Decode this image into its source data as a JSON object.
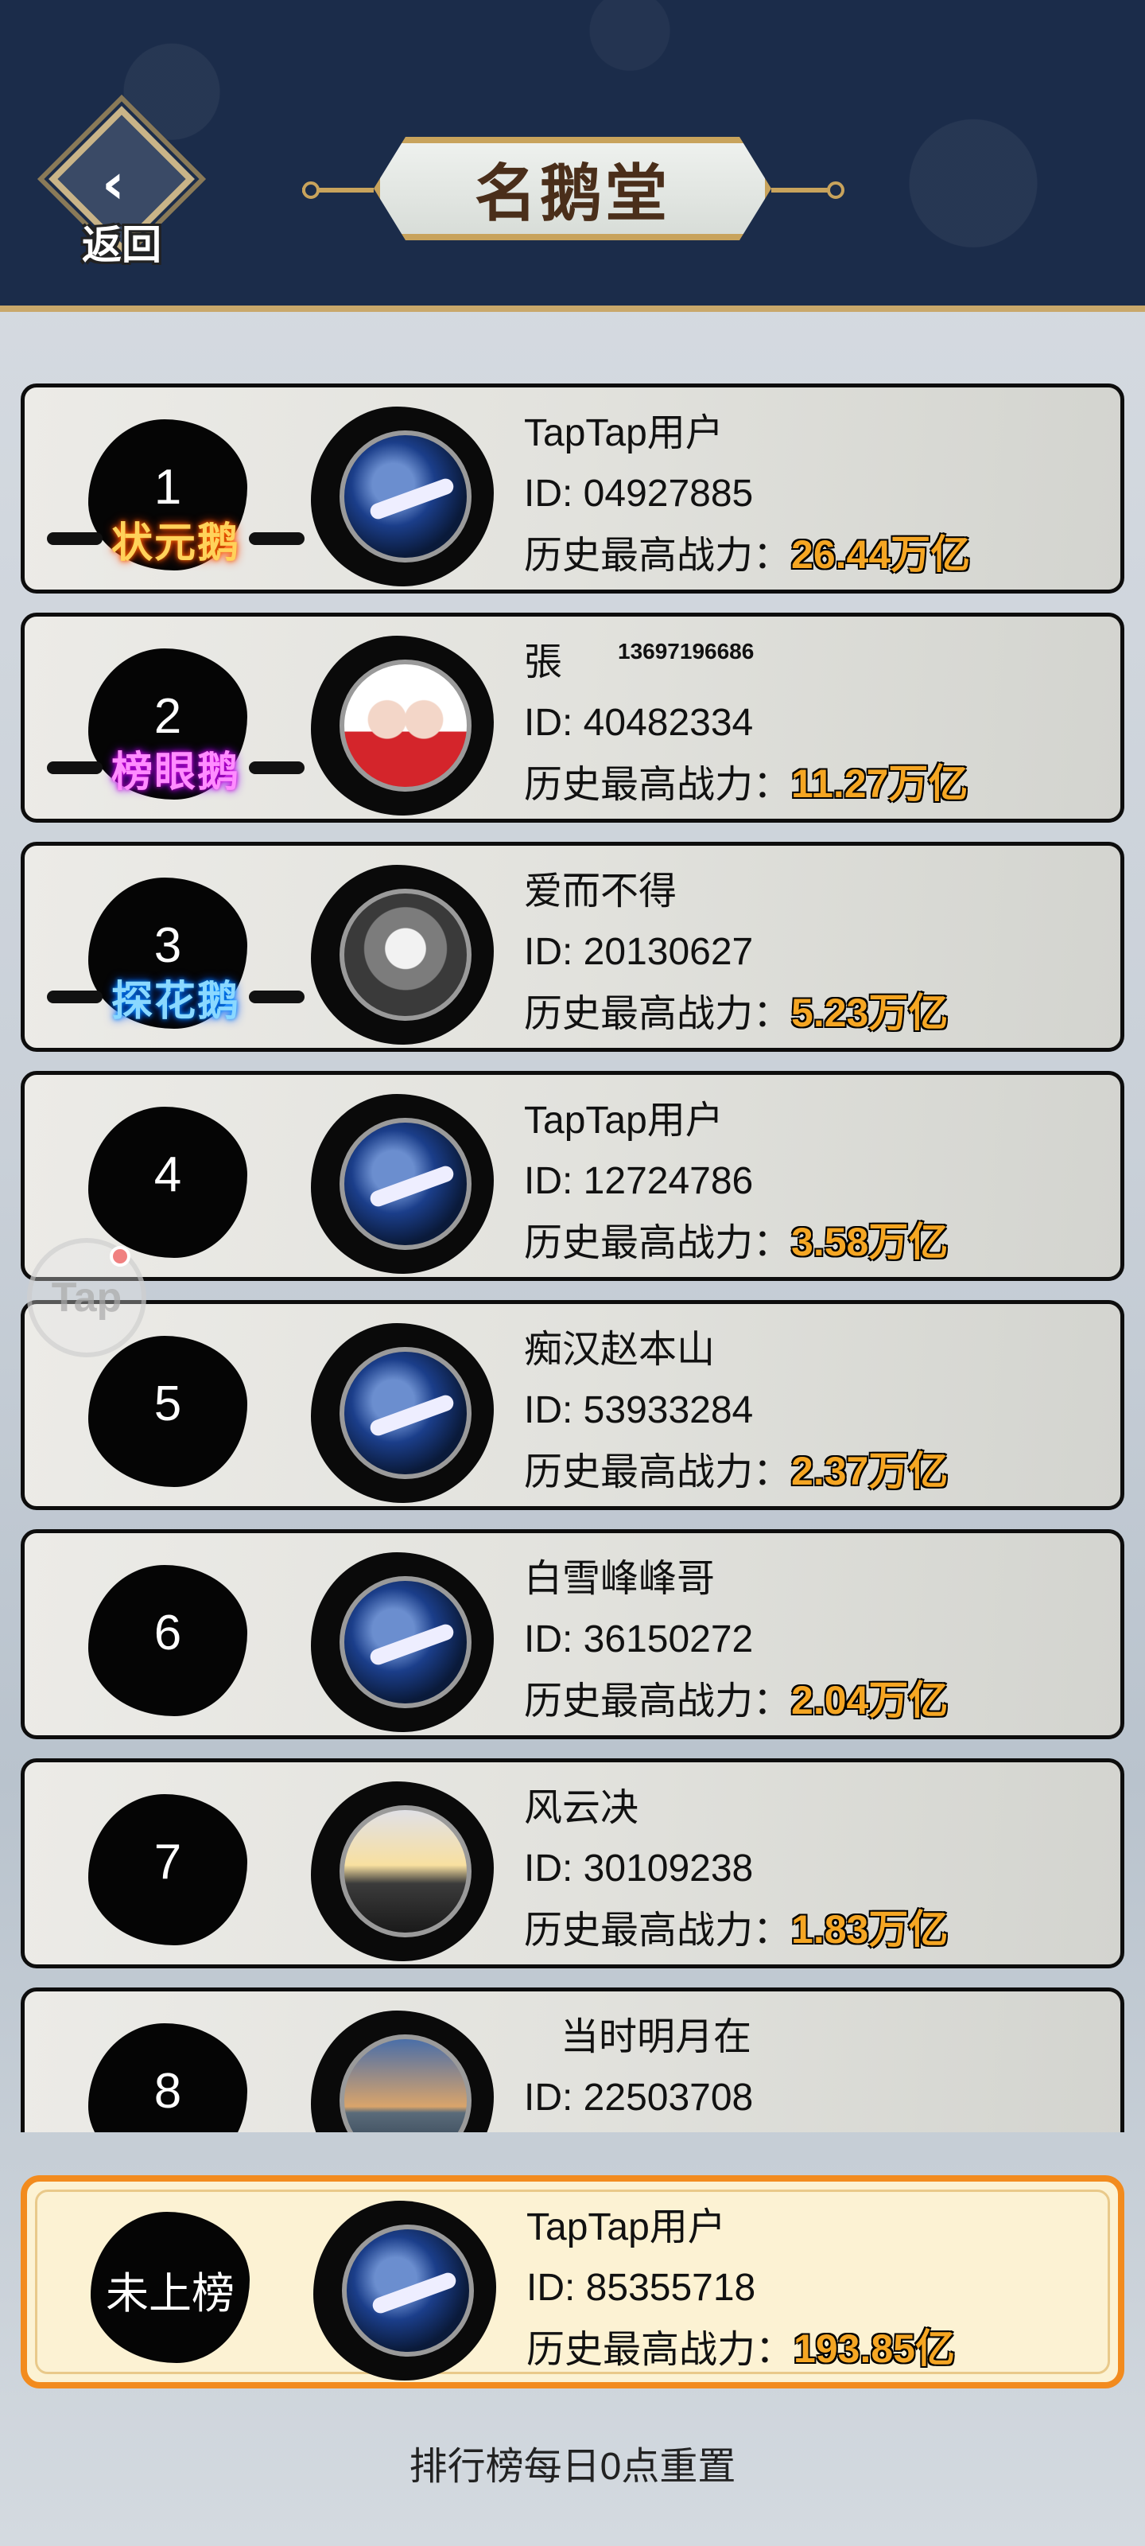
{
  "header": {
    "back_label": "返回",
    "title": "名鹅堂"
  },
  "rankings": [
    {
      "rank": "1",
      "title": "状元鹅",
      "name": "TapTap用户",
      "name_extra": "",
      "id": "ID: 04927885",
      "power_label": "历史最高战力：",
      "power": "26.44万亿",
      "avatar": "blue-bird-avatar"
    },
    {
      "rank": "2",
      "title": "榜眼鹅",
      "name": "張",
      "name_extra": "13697196686",
      "id": "ID: 40482334",
      "power_label": "历史最高战力：",
      "power": "11.27万亿",
      "avatar": "cartoon-couple-avatar"
    },
    {
      "rank": "3",
      "title": "探花鹅",
      "name": "爱而不得",
      "name_extra": "",
      "id": "ID: 20130627",
      "power_label": "历史最高战力：",
      "power": "5.23万亿",
      "avatar": "penguin-avatar"
    },
    {
      "rank": "4",
      "title": "",
      "name": "TapTap用户",
      "name_extra": "",
      "id": "ID: 12724786",
      "power_label": "历史最高战力：",
      "power": "3.58万亿",
      "avatar": "blue-bird-avatar"
    },
    {
      "rank": "5",
      "title": "",
      "name": "痴汉赵本山",
      "name_extra": "",
      "id": "ID: 53933284",
      "power_label": "历史最高战力：",
      "power": "2.37万亿",
      "avatar": "blue-bird-avatar"
    },
    {
      "rank": "6",
      "title": "",
      "name": "白雪峰峰哥",
      "name_extra": "",
      "id": "ID: 36150272",
      "power_label": "历史最高战力：",
      "power": "2.04万亿",
      "avatar": "blue-bird-avatar"
    },
    {
      "rank": "7",
      "title": "",
      "name": "风云决",
      "name_extra": "",
      "id": "ID: 30109238",
      "power_label": "历史最高战力：",
      "power": "1.83万亿",
      "avatar": "sunset-avatar"
    },
    {
      "rank": "8",
      "title": "",
      "name": "当时明月在",
      "name_extra": "",
      "id": "ID: 22503708",
      "power_label": "历史最高战力：",
      "power": "",
      "avatar": "beach-avatar"
    }
  ],
  "my_rank": {
    "rank": "未上榜",
    "name": "TapTap用户",
    "id": "ID: 85355718",
    "power_label": "历史最高战力：",
    "power": "193.85亿",
    "avatar": "blue-bird-avatar"
  },
  "floating_button": {
    "label": "Tap"
  },
  "footer": {
    "note": "排行榜每日0点重置"
  }
}
